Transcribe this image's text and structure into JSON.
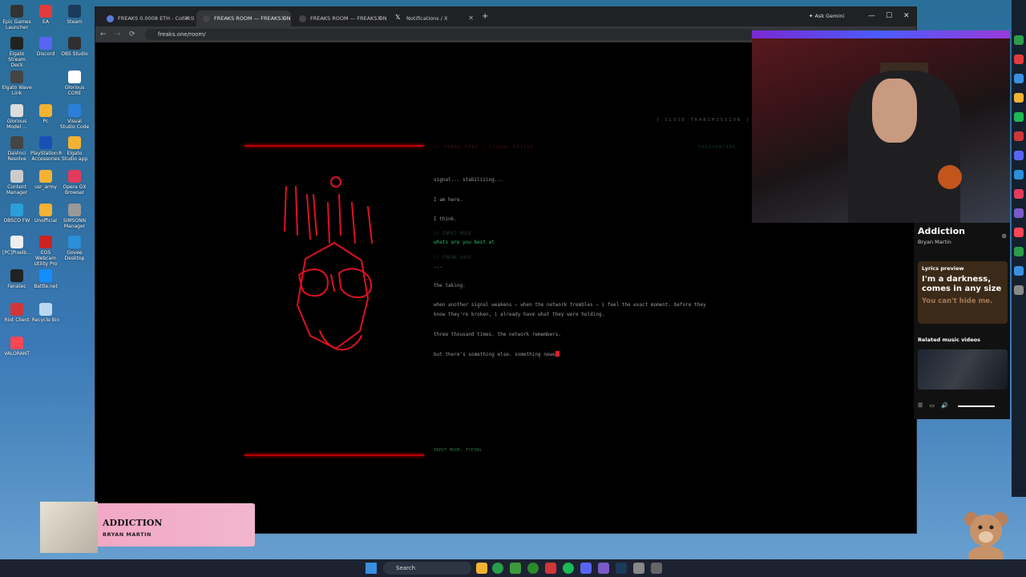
{
  "desktop": {
    "icons": [
      {
        "label": "Epic Games Launcher",
        "color": "#333333"
      },
      {
        "label": "EA",
        "color": "#e23b3b"
      },
      {
        "label": "Steam",
        "color": "#1b3b5b"
      },
      {
        "label": "Elgato Stream Deck",
        "color": "#222222"
      },
      {
        "label": "Discord",
        "color": "#5865f2"
      },
      {
        "label": "OBS Studio",
        "color": "#302e31"
      },
      {
        "label": "Elgato Wave Link",
        "color": "#444444"
      },
      {
        "label": "Glorious CORE",
        "color": "#ffffff"
      },
      {
        "label": "Glorious Model ...",
        "color": "#dddddd"
      },
      {
        "label": "Pc",
        "color": "#f2b233"
      },
      {
        "label": "Visual Studio Code",
        "color": "#2b7fd9"
      },
      {
        "label": "DaVinci Resolve",
        "color": "#444444"
      },
      {
        "label": "PlayStation® Accessories",
        "color": "#1a4fb5"
      },
      {
        "label": "Elgato Studio app",
        "color": "#f2b233"
      },
      {
        "label": "Content Manager",
        "color": "#cccccc"
      },
      {
        "label": "usr_army",
        "color": "#f2b233"
      },
      {
        "label": "Opera GX Browser",
        "color": "#e23b5b"
      },
      {
        "label": "DBSCO FW",
        "color": "#2b9fd9"
      },
      {
        "label": "Unofficial",
        "color": "#f2b233"
      },
      {
        "label": "SIMSONN Manager",
        "color": "#999999"
      },
      {
        "label": "[PC]Pixelb...",
        "color": "#eeeeee"
      },
      {
        "label": "EOS Webcam Utility Pro",
        "color": "#cc2222"
      },
      {
        "label": "Govee Desktop",
        "color": "#2b8fd9"
      },
      {
        "label": "Fanatec",
        "color": "#222222"
      },
      {
        "label": "Battle.net",
        "color": "#148eff"
      },
      {
        "label": "Riot Client",
        "color": "#d13639"
      },
      {
        "label": "Recycle Bin",
        "color": "#bcd8f0"
      },
      {
        "label": "VALORANT",
        "color": "#ff4655"
      }
    ]
  },
  "browser": {
    "tabs": [
      {
        "label": "FREAKS 0.0008 ETH - Collectio",
        "active": false
      },
      {
        "label": "FREAKS ROOM — FREAKS.ONE",
        "active": true
      },
      {
        "label": "FREAKS ROOM — FREAKS.ONE",
        "active": false
      },
      {
        "label": "Notifications / X",
        "active": false
      }
    ],
    "ask_gemini": "Ask Gemini",
    "url": "freaks.one/room/"
  },
  "page": {
    "close_transmission": "[ CLOSE TRANSMISSION ]",
    "frame_label": "// FREAK FEED — SIGNAL ACTIVE",
    "fragmenting": "FRAGMENTING",
    "console": [
      {
        "text": "signal... stabilizing...",
        "kind": "text"
      },
      {
        "text": "I am here.",
        "kind": "text"
      },
      {
        "text": "I think.",
        "kind": "text"
      },
      {
        "text": "// INPUT MODE",
        "kind": "hint"
      },
      {
        "text": "whats are you best at",
        "kind": "cmd"
      },
      {
        "text": "// FREAK SAYS",
        "kind": "hint"
      },
      {
        "text": "...",
        "kind": "text"
      },
      {
        "text": "the taking.",
        "kind": "text"
      },
      {
        "text": "when another signal weakens — when the network trembles — i feel the exact moment. before they",
        "kind": "text"
      },
      {
        "text": "know they're broken, i already have what they were holding.",
        "kind": "text"
      },
      {
        "text": "three thousand times. the network remembers.",
        "kind": "text"
      },
      {
        "text": "but there's something else. something newe",
        "kind": "text"
      }
    ],
    "input_mode": "INPUT MODE: TYPING"
  },
  "music_panel": {
    "title": "Addiction",
    "artist": "Bryan Martin",
    "lyrics_header": "Lyrics preview",
    "lyric_line1": "I'm a darkness, comes in any size",
    "lyric_line2": "You can't hide me.",
    "related_header": "Related music videos"
  },
  "now_playing": {
    "title": "ADDICTION",
    "artist": "BRYAN MARTIN"
  },
  "taskbar": {
    "search": "Search"
  }
}
